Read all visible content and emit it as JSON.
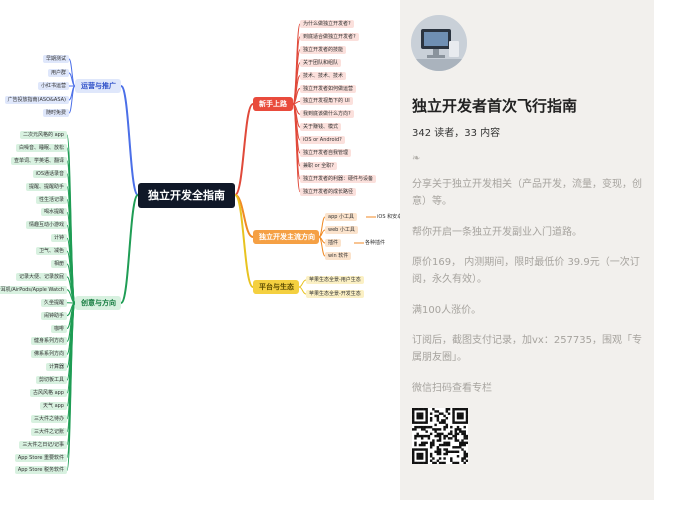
{
  "mindmap": {
    "root": "独立开发全指南",
    "branches": {
      "operations": {
        "label": "运营与推广",
        "color": "#4b6fe8",
        "items": [
          "早期测试",
          "用户群",
          "小红书运营",
          "广告投放指南(ASO&ASA)",
          "随时免费"
        ]
      },
      "ideas": {
        "label": "创意与方向",
        "color": "#1f9d55",
        "items": [
          "二次元风格的 app",
          "白噪音、睡眠、放松",
          "查单词、学英语、翻译",
          "iOS通话录音",
          "提醒、提醒助手",
          "性生活记录",
          "喝水提醒",
          "情趣互动小游戏",
          "计钟",
          "卫气、减色",
          "相册",
          "记录大便、记录放屁",
          "蓝牙耳机/AirPods/Apple Watch",
          "久坐提醒",
          "闹钟助手",
          "咖啡",
          "健身系列方向",
          "佛系系列方向",
          "计算器",
          "剪切板工具",
          "古风风格 app",
          "天气 app",
          "三大件之待办",
          "三大件之记账",
          "三大件之日记/记事",
          "App Store 重要软件",
          "App Store 税务软件"
        ]
      },
      "beginner": {
        "label": "新手上路",
        "color": "#e0493a",
        "items": [
          "为什么做独立开发者?",
          "到底适合做独立开发者?",
          "独立开发者的技能",
          "关于团队和组队",
          "技术、技术、技术",
          "独立开发者如何做运营",
          "独立开发视角下的 UI",
          "我到底该做什么方向?",
          "关于赚钱、模式",
          "iOS or Android?",
          "独立开发者自我管理",
          "兼职 or 全职?",
          "独立开发者的利器：硬件与设备",
          "独立开发者的成长路径"
        ]
      },
      "mainstream": {
        "label": "独立开发主流方向",
        "color": "#f08a24",
        "items": [
          {
            "label": "app 小工具",
            "sub": "iOS 和安卓"
          },
          {
            "label": "web 小工具",
            "sub": ""
          },
          {
            "label": "插件",
            "sub": "各种插件"
          },
          {
            "label": "win 软件",
            "sub": ""
          }
        ]
      },
      "platform": {
        "label": "平台与生态",
        "color": "#e8c320",
        "items": [
          "苹果生态全景-用户生态",
          "苹果生态全景-开发生态"
        ]
      }
    }
  },
  "panel": {
    "title": "独立开发者首次飞行指南",
    "stats": "342 读者，33 内容",
    "glyph": "❧",
    "paragraphs": [
      "分享关于独立开发相关（产品开发，流量，变现，创意）等。",
      "帮你开启一条独立开发副业入门道路。",
      "原价169， 内测期间，限时最低价 39.9元（一次订阅，永久有效）。",
      "满100人涨价。",
      "订阅后，截图支付记录，加vx：257735，围观「专属朋友圈」。",
      "微信扫码查看专栏"
    ]
  }
}
